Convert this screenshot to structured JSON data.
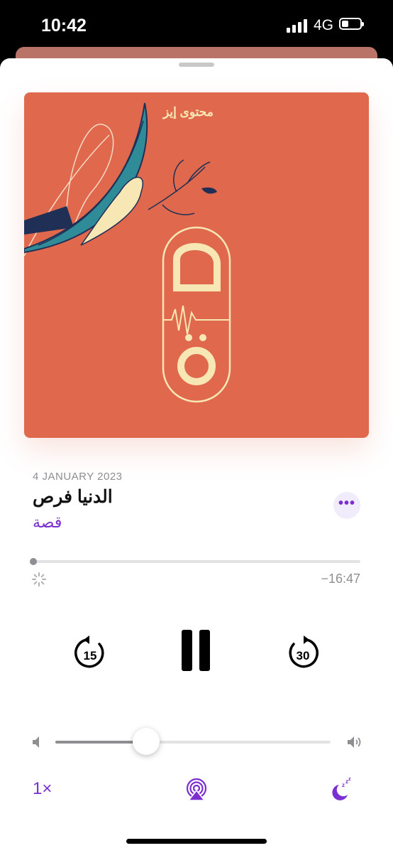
{
  "status_bar": {
    "time": "10:42",
    "network": "4G"
  },
  "artwork": {
    "brand_text": "محتوى إيز",
    "background_color": "#e0694d"
  },
  "episode": {
    "date": "4 JANUARY 2023",
    "title": "الدنيا فرص",
    "show": "قصة"
  },
  "more_button": {
    "label": "•••"
  },
  "progress": {
    "played_fraction": 0.0,
    "remaining": "−16:47"
  },
  "controls": {
    "skip_back_seconds": "15",
    "skip_forward_seconds": "30"
  },
  "volume": {
    "level": 0.33
  },
  "bottom_bar": {
    "speed": "1×"
  },
  "colors": {
    "accent": "#7b2fd1",
    "secondary_text": "#8e8e93"
  }
}
